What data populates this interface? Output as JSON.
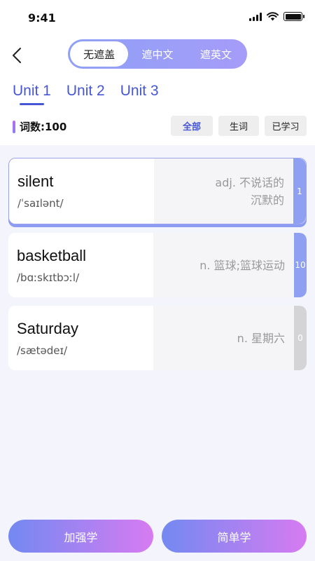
{
  "status_bar": {
    "time": "9:41",
    "icons": [
      "signal-icon",
      "wifi-icon",
      "battery-icon"
    ]
  },
  "header": {
    "back_icon": "chevron-left-icon",
    "mask_options": [
      "无遮盖",
      "遮中文",
      "遮英文"
    ],
    "mask_selected": "无遮盖"
  },
  "unit_tabs": [
    "Unit 1",
    "Unit 2",
    "Unit 3"
  ],
  "unit_selected": "Unit 1",
  "word_count_label": "词数:100",
  "filters": [
    "全部",
    "生词",
    "已学习"
  ],
  "filter_selected": "全部",
  "words": [
    {
      "en": "silent",
      "ipa": "/ˈsaɪlənt/",
      "cn_lines": [
        "adj. 不说话的",
        "沉默的"
      ],
      "badge": "1",
      "badge_color": "#8fa0f2",
      "selected": true
    },
    {
      "en": "basketball",
      "ipa": "/bɑːskɪtbɔːl/",
      "cn_lines": [
        "n. 篮球;篮球运动"
      ],
      "badge": "10",
      "badge_color": "#8fa0f2",
      "selected": false
    },
    {
      "en": "Saturday",
      "ipa": "/sætədeɪ/",
      "cn_lines": [
        "n. 星期六"
      ],
      "badge": "0",
      "badge_color": "#d4d4d6",
      "selected": false
    }
  ],
  "bottom_buttons": {
    "intensive": "加强学",
    "simple": "简单学"
  },
  "colors": {
    "accent": "#4656d6",
    "gradient_start": "#7389f1",
    "gradient_end": "#d77bf1",
    "background": "#f4f4fd"
  }
}
